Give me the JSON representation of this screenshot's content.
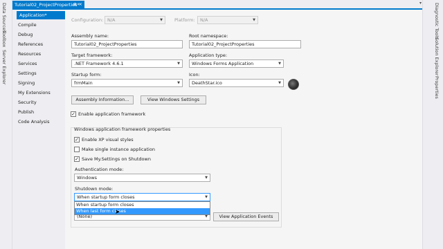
{
  "document_tab": {
    "title": "Tutorial02_ProjectProperties*",
    "pin": "⊕",
    "close": "×"
  },
  "left_tool_windows": [
    "Data Sources",
    "Toolbox",
    "Server Explorer"
  ],
  "right_tool_windows": [
    "Diagnostic Tools",
    "Solution Explorer",
    "Properties"
  ],
  "sidenav": {
    "items": [
      {
        "label": "Application*"
      },
      {
        "label": "Compile"
      },
      {
        "label": "Debug"
      },
      {
        "label": "References"
      },
      {
        "label": "Resources"
      },
      {
        "label": "Services"
      },
      {
        "label": "Settings"
      },
      {
        "label": "Signing"
      },
      {
        "label": "My Extensions"
      },
      {
        "label": "Security"
      },
      {
        "label": "Publish"
      },
      {
        "label": "Code Analysis"
      }
    ]
  },
  "config": {
    "configuration_label": "Configuration:",
    "configuration_value": "N/A",
    "platform_label": "Platform:",
    "platform_value": "N/A"
  },
  "assembly_name": {
    "label": "Assembly name:",
    "value": "Tutorial02_ProjectProperties"
  },
  "root_namespace": {
    "label": "Root namespace:",
    "value": "Tutorial02_ProjectProperties"
  },
  "target_framework": {
    "label": "Target framework:",
    "value": ".NET Framework 4.6.1"
  },
  "application_type": {
    "label": "Application type:",
    "value": "Windows Forms Application"
  },
  "startup_form": {
    "label": "Startup form:",
    "value": "frmMain"
  },
  "icon": {
    "label": "Icon:",
    "value": "DeathStar.ico"
  },
  "buttons": {
    "assembly_information": "Assembly Information...",
    "view_windows_settings": "View Windows Settings",
    "view_application_events": "View Application Events"
  },
  "enable_app_framework": {
    "label": "Enable application framework",
    "checked": true
  },
  "framework_props": {
    "title": "Windows application framework properties",
    "enable_xp_styles": {
      "label": "Enable XP visual styles",
      "checked": true
    },
    "single_instance": {
      "label": "Make single instance application",
      "checked": false
    },
    "save_settings": {
      "label": "Save My.Settings on Shutdown",
      "checked": true
    },
    "auth_mode_label": "Authentication mode:",
    "auth_mode_value": "Windows",
    "shutdown_mode_label": "Shutdown mode:",
    "shutdown_mode_value": "When startup form closes",
    "shutdown_options": [
      "When startup form closes",
      "When last form closes"
    ],
    "splash_value": "(None)"
  }
}
